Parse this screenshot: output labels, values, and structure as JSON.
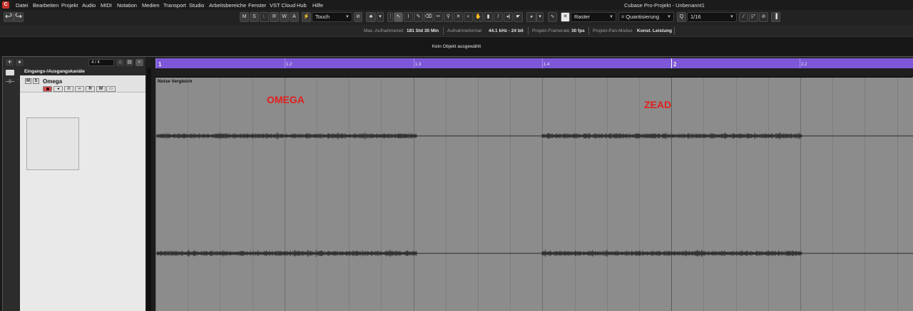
{
  "menubar": {
    "items": [
      "Datei",
      "Bearbeiten",
      "Projekt",
      "Audio",
      "MIDI",
      "Notation",
      "Medien",
      "Transport",
      "Studio",
      "Arbeitsbereiche",
      "Fenster",
      "VST Cloud",
      "Hub",
      "Hilfe"
    ],
    "window_title": "Cubase Pro-Projekt - Unbenannt1"
  },
  "toolbar": {
    "msrwa": [
      "M",
      "S",
      "L",
      "R",
      "W",
      "A"
    ],
    "automation_mode": "Touch",
    "grid_type": "Raster",
    "quantize_label": "Quantisierung",
    "quantize_value": "1/16"
  },
  "infobar": {
    "max_rec_label": "Max. Aufnahmezeit",
    "max_rec_value": "181 Std 30 Min",
    "rec_format_label": "Aufnahmeformat",
    "rec_format_value": "44.1 kHz - 24 bit",
    "framerate_label": "Projekt-Framerate",
    "framerate_value": "30 fps",
    "pan_mode_label": "Projekt-Pan-Modus",
    "pan_mode_value": "Konst. Leistung"
  },
  "status": {
    "no_selection": "Kein Objekt ausgewählt"
  },
  "tracklist": {
    "counter": "4 / 4",
    "folder_label": "Eingangs-/Ausgangskanäle",
    "track_name": "Omega",
    "track_m": "M",
    "track_s": "S",
    "track_r": "R",
    "track_w": "W"
  },
  "ruler": {
    "labels": [
      "1",
      "1.2",
      "1.3",
      "1.4",
      "2",
      "2.2"
    ]
  },
  "event": {
    "name": "Noise Vergleich",
    "annotation_left": "OMEGA",
    "annotation_right": "ZEAD"
  },
  "colors": {
    "ruler_purple": "#7d57d8",
    "annotation_red": "#e0201e",
    "track_bg": "#8c8c8c"
  }
}
